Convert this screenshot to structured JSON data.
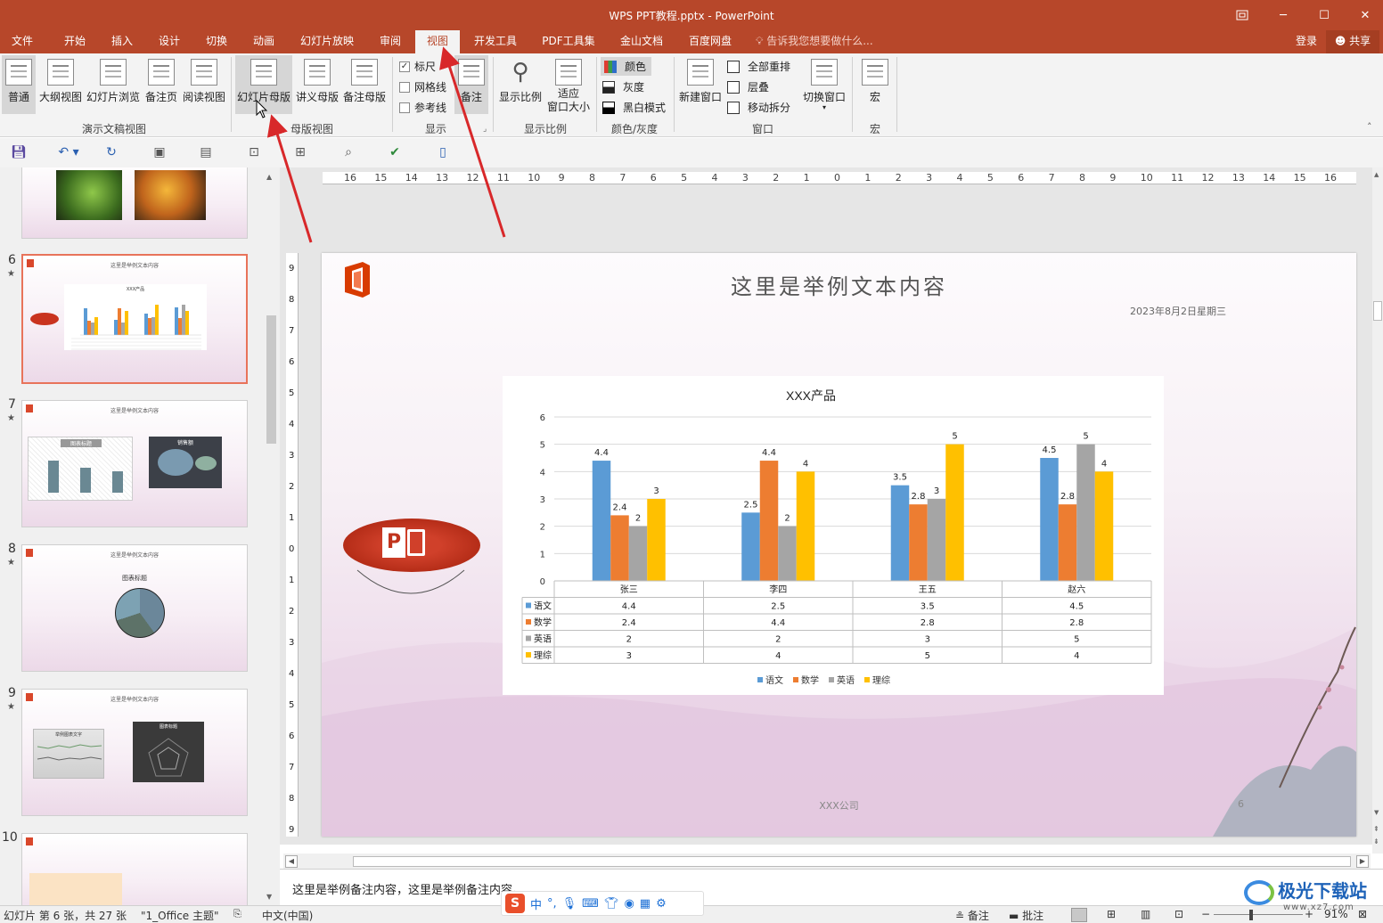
{
  "window": {
    "title": "WPS PPT教程.pptx - PowerPoint",
    "controls": {
      "restore_icon": "restore-icon",
      "minimize": "─",
      "maximize": "☐",
      "close": "✕"
    }
  },
  "menu": {
    "tabs": [
      "文件",
      "开始",
      "插入",
      "设计",
      "切换",
      "动画",
      "幻灯片放映",
      "审阅",
      "视图",
      "开发工具",
      "PDF工具集",
      "金山文档",
      "百度网盘"
    ],
    "active": "视图",
    "tell_me": "告诉我您想要做什么...",
    "login": "登录",
    "share": "共享"
  },
  "ribbon": {
    "presentation_views": {
      "label": "演示文稿视图",
      "buttons": [
        "普通",
        "大纲视图",
        "幻灯片浏览",
        "备注页",
        "阅读视图"
      ]
    },
    "master_views": {
      "label": "母版视图",
      "buttons": [
        "幻灯片母版",
        "讲义母版",
        "备注母版"
      ]
    },
    "show": {
      "label": "显示",
      "ruler": "标尺",
      "gridlines": "网格线",
      "guides": "参考线",
      "notes": "备注"
    },
    "zoom": {
      "label": "显示比例",
      "zoom_btn": "显示比例",
      "fit_btn_line1": "适应",
      "fit_btn_line2": "窗口大小"
    },
    "color": {
      "label": "颜色/灰度",
      "color": "颜色",
      "grayscale": "灰度",
      "bw": "黑白模式"
    },
    "window": {
      "label": "窗口",
      "new_window": "新建窗口",
      "arrange_all": "全部重排",
      "cascade": "层叠",
      "move_split": "移动拆分",
      "switch_windows": "切换窗口"
    },
    "macro": {
      "label": "宏",
      "button": "宏"
    }
  },
  "thumbnails": [
    {
      "num": "6",
      "star": "★",
      "selected": true,
      "title": "这里是举例文本内容",
      "chart_title": "XXX产品"
    },
    {
      "num": "7",
      "star": "★",
      "title": "这里是举例文本内容",
      "left_title": "图表标题",
      "right_title": "销售额"
    },
    {
      "num": "8",
      "star": "★",
      "title": "这里是举例文本内容",
      "chart_title": "图表标题"
    },
    {
      "num": "9",
      "star": "★",
      "title": "这里是举例文本内容",
      "left_title": "举例图表文字",
      "right_title": "图表标题"
    },
    {
      "num": "10",
      "star": ""
    }
  ],
  "ruler": {
    "h_ticks": [
      "16",
      "15",
      "14",
      "13",
      "12",
      "11",
      "10",
      "9",
      "8",
      "7",
      "6",
      "5",
      "4",
      "3",
      "2",
      "1",
      "0",
      "1",
      "2",
      "3",
      "4",
      "5",
      "6",
      "7",
      "8",
      "9",
      "10",
      "11",
      "12",
      "13",
      "14",
      "15",
      "16"
    ],
    "v_ticks": [
      "9",
      "8",
      "7",
      "6",
      "5",
      "4",
      "3",
      "2",
      "1",
      "0",
      "1",
      "2",
      "3",
      "4",
      "5",
      "6",
      "7",
      "8",
      "9"
    ]
  },
  "slide": {
    "title": "这里是举例文本内容",
    "date": "2023年8月2日星期三",
    "footer": "XXX公司",
    "page": "6"
  },
  "chart_data": {
    "type": "bar",
    "title": "XXX产品",
    "categories": [
      "张三",
      "李四",
      "王五",
      "赵六"
    ],
    "series": [
      {
        "name": "语文",
        "values": [
          4.4,
          2.5,
          3.5,
          4.5
        ],
        "color": "#5b9bd5"
      },
      {
        "name": "数学",
        "values": [
          2.4,
          4.4,
          2.8,
          2.8
        ],
        "color": "#ed7d31"
      },
      {
        "name": "英语",
        "values": [
          2,
          2,
          3,
          5
        ],
        "color": "#a5a5a5"
      },
      {
        "name": "理综",
        "values": [
          3,
          4,
          5,
          4
        ],
        "color": "#ffc000"
      }
    ],
    "ylim": [
      0,
      6
    ],
    "yticks": [
      0,
      1,
      2,
      3,
      4,
      5,
      6
    ],
    "grid": true,
    "data_table": true,
    "legend": "bottom"
  },
  "notes": {
    "text": "这里是举例备注内容，这里是举例备注内容。"
  },
  "status": {
    "slide_info": "幻灯片 第 6 张，共 27 张",
    "theme": "\"1_Office 主题\"",
    "language": "中文(中国)",
    "notes_btn": "备注",
    "comments_btn": "批注",
    "zoom": "91%"
  },
  "ime": {
    "items": [
      "中",
      "°,",
      "mic",
      "kbd",
      "shirt",
      "game",
      "grid",
      "gear"
    ]
  },
  "watermark": {
    "text": "极光下载站",
    "url": "www.xz7.com"
  }
}
